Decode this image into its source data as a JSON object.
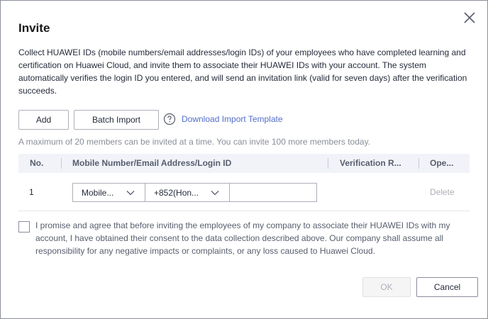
{
  "dialog": {
    "title": "Invite",
    "description": "Collect HUAWEI IDs (mobile numbers/email addresses/login IDs) of your employees who have completed learning and certification on Huawei Cloud, and invite them to associate their HUAWEI IDs with your account. The system automatically verifies the login ID you entered, and will send an invitation link (valid for seven days) after the verification succeeds.",
    "close_icon": "close-icon"
  },
  "toolbar": {
    "add_label": "Add",
    "batch_import_label": "Batch Import",
    "help_icon": "question-circle-icon",
    "download_template_label": "Download Import Template"
  },
  "hint": "A maximum of 20 members can be invited at a time. You can invite 100 more members today.",
  "table": {
    "columns": [
      "No.",
      "Mobile Number/Email Address/Login ID",
      "Verification R...",
      "Ope..."
    ],
    "rows": [
      {
        "no": "1",
        "id_type": "Mobile...",
        "country_code": "+852(Hon...",
        "value": "",
        "action": "Delete"
      }
    ]
  },
  "agreement": {
    "checked": false,
    "text": "I promise and agree that before inviting the employees of my company to associate their HUAWEI IDs with my account, I have obtained their consent to the data collection described above. Our company shall assume all responsibility for any negative impacts or complaints, or any loss caused to Huawei Cloud."
  },
  "footer": {
    "ok_label": "OK",
    "cancel_label": "Cancel"
  },
  "colors": {
    "link": "#526ecc",
    "header_bg": "#f1f3f9",
    "disabled_text": "#adb0b8"
  }
}
